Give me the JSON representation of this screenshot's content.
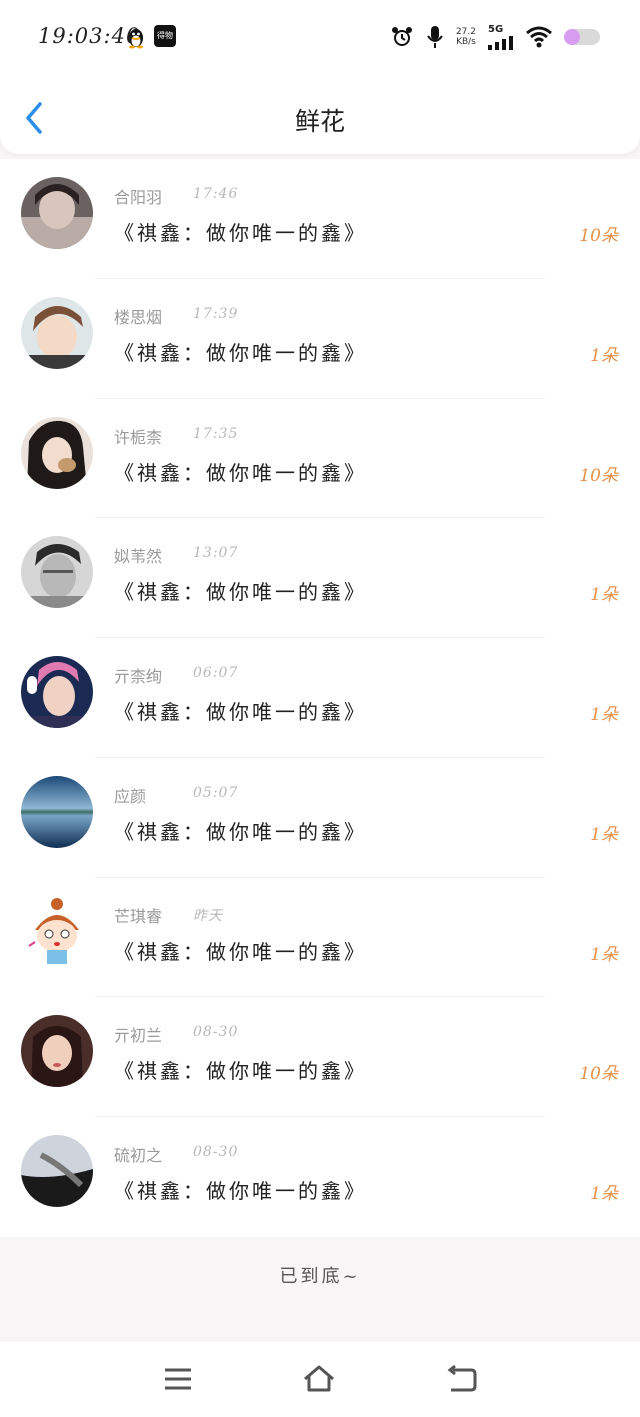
{
  "status_bar": {
    "time": "19:03:40",
    "app_badge": "得物",
    "speed_value": "27.2",
    "speed_unit": "KB/s",
    "network": "5G",
    "battery_level": 0.45
  },
  "header": {
    "title": "鲜花"
  },
  "rows": [
    {
      "name": "合阳羽",
      "time": "17:46",
      "message": "《祺鑫：做你唯一的鑫》",
      "count": "10朵"
    },
    {
      "name": "楼思烟",
      "time": "17:39",
      "message": "《祺鑫：做你唯一的鑫》",
      "count": "1朵"
    },
    {
      "name": "许栀柰",
      "time": "17:35",
      "message": "《祺鑫：做你唯一的鑫》",
      "count": "10朵"
    },
    {
      "name": "姒苇然",
      "time": "13:07",
      "message": "《祺鑫：做你唯一的鑫》",
      "count": "1朵"
    },
    {
      "name": "亓柰绚",
      "time": "06:07",
      "message": "《祺鑫：做你唯一的鑫》",
      "count": "1朵"
    },
    {
      "name": "应颜",
      "time": "05:07",
      "message": "《祺鑫：做你唯一的鑫》",
      "count": "1朵"
    },
    {
      "name": "芒琪睿",
      "time": "昨天",
      "message": "《祺鑫：做你唯一的鑫》",
      "count": "1朵"
    },
    {
      "name": "亓初兰",
      "time": "08-30",
      "message": "《祺鑫：做你唯一的鑫》",
      "count": "10朵"
    },
    {
      "name": "硫初之",
      "time": "08-30",
      "message": "《祺鑫：做你唯一的鑫》",
      "count": "1朵"
    }
  ],
  "footer": {
    "end_text": "已到底~"
  },
  "colors": {
    "accent_blue": "#2a8ee8",
    "count_orange": "#e89048"
  },
  "icons": {
    "back": "chevron-left-icon",
    "menu": "menu-icon",
    "home": "home-icon",
    "return": "back-arrow-icon"
  }
}
